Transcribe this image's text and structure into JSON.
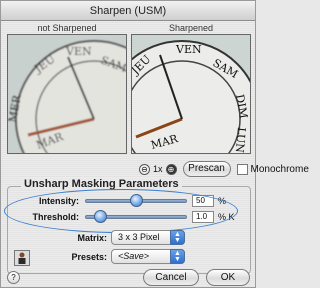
{
  "window": {
    "title": "Sharpen (USM)"
  },
  "preview": {
    "left_label": "not Sharpened",
    "right_label": "Sharpened",
    "dial_letters": [
      "JEU",
      "VEN",
      "SAM",
      "DIM",
      "LUN",
      "MAR",
      "MER"
    ]
  },
  "zoom": {
    "minus": "⊖",
    "level": "1x",
    "plus": "⊕"
  },
  "prescan_label": "Prescan",
  "monochrome_label": "Monochrome",
  "usm": {
    "group_title": "Unsharp Masking Parameters",
    "intensity_label": "Intensity:",
    "intensity_value": "50",
    "intensity_unit": "%",
    "intensity_level": 0.5,
    "threshold_label": "Threshold:",
    "threshold_value": "1.0",
    "threshold_unit": "% K",
    "threshold_level": 0.1,
    "matrix_label": "Matrix:",
    "matrix_value": "3 x 3 Pixel",
    "presets_label": "Presets:",
    "presets_value": "<Save>"
  },
  "buttons": {
    "cancel": "Cancel",
    "ok": "OK",
    "help": "?"
  },
  "colors": {
    "accent": "#3a7fd0"
  }
}
